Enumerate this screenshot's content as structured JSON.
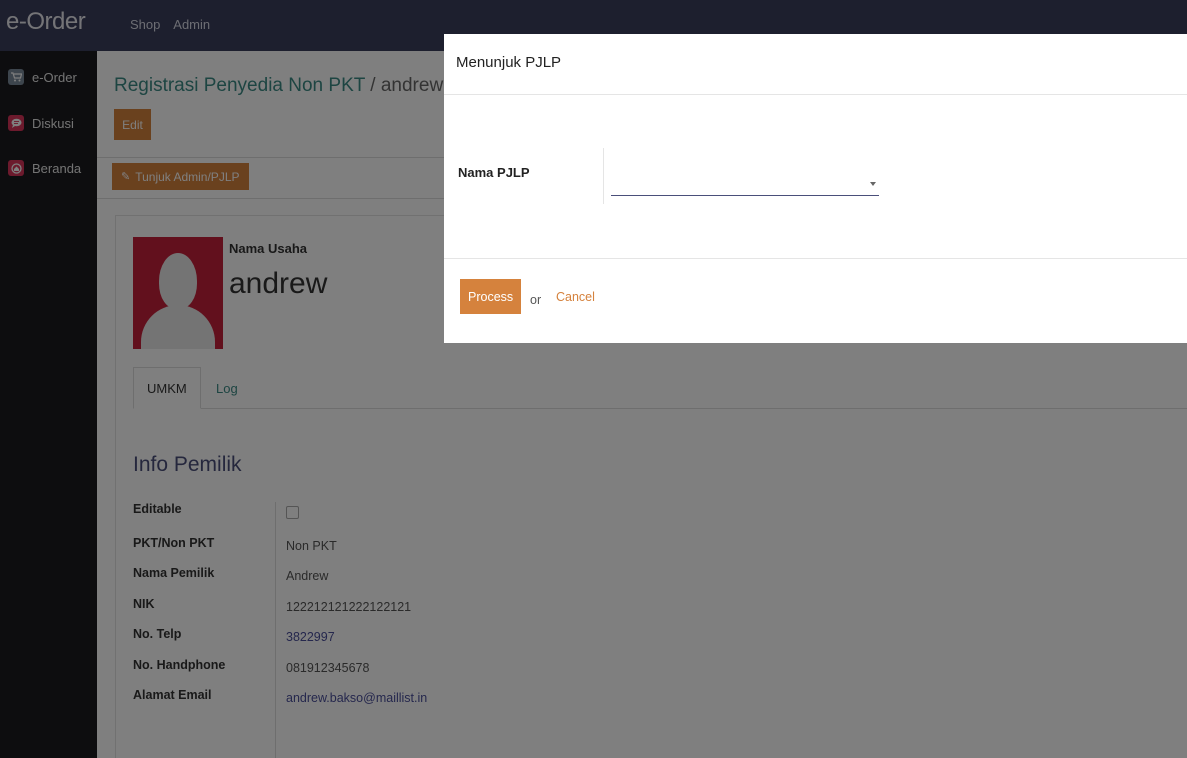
{
  "app": {
    "brand": "e-Order",
    "top_menu": [
      "Shop",
      "Admin"
    ]
  },
  "sidebar": {
    "items": [
      {
        "label": "e-Order",
        "icon": "cart-icon",
        "color": "#7a8a9a"
      },
      {
        "label": "Diskusi",
        "icon": "chat-icon",
        "color": "#d9345a"
      },
      {
        "label": "Beranda",
        "icon": "home-icon",
        "color": "#d9345a"
      }
    ]
  },
  "page": {
    "breadcrumb_parent": "Registrasi Penyedia Non PKT",
    "breadcrumb_sep": " / ",
    "breadcrumb_current": "andrew",
    "edit_label": "Edit",
    "assign_label": "Tunjuk Admin/PJLP",
    "name_label": "Nama Usaha",
    "name_value": "andrew",
    "tabs": [
      "UMKM",
      "Log"
    ],
    "section_title": "Info Pemilik",
    "fields": [
      {
        "label": "Editable",
        "value": "",
        "type": "checkbox"
      },
      {
        "label": "PKT/Non PKT",
        "value": "Non PKT"
      },
      {
        "label": "Nama Pemilik",
        "value": "Andrew"
      },
      {
        "label": "NIK",
        "value": "122212121222122121"
      },
      {
        "label": "No. Telp",
        "value": "3822997",
        "link": true
      },
      {
        "label": "No. Handphone",
        "value": "081912345678"
      },
      {
        "label": "Alamat Email",
        "value": "andrew.bakso@maillist.in",
        "link": true
      }
    ]
  },
  "modal": {
    "title": "Menunjuk PJLP",
    "field_label": "Nama PJLP",
    "select_value": "",
    "process_label": "Process",
    "or_text": "or",
    "cancel_label": "Cancel"
  },
  "colors": {
    "navbar": "#3a3e5c",
    "sidebar": "#1b1b1f",
    "accent_orange": "#d5823d",
    "link_teal": "#3a8a85"
  }
}
